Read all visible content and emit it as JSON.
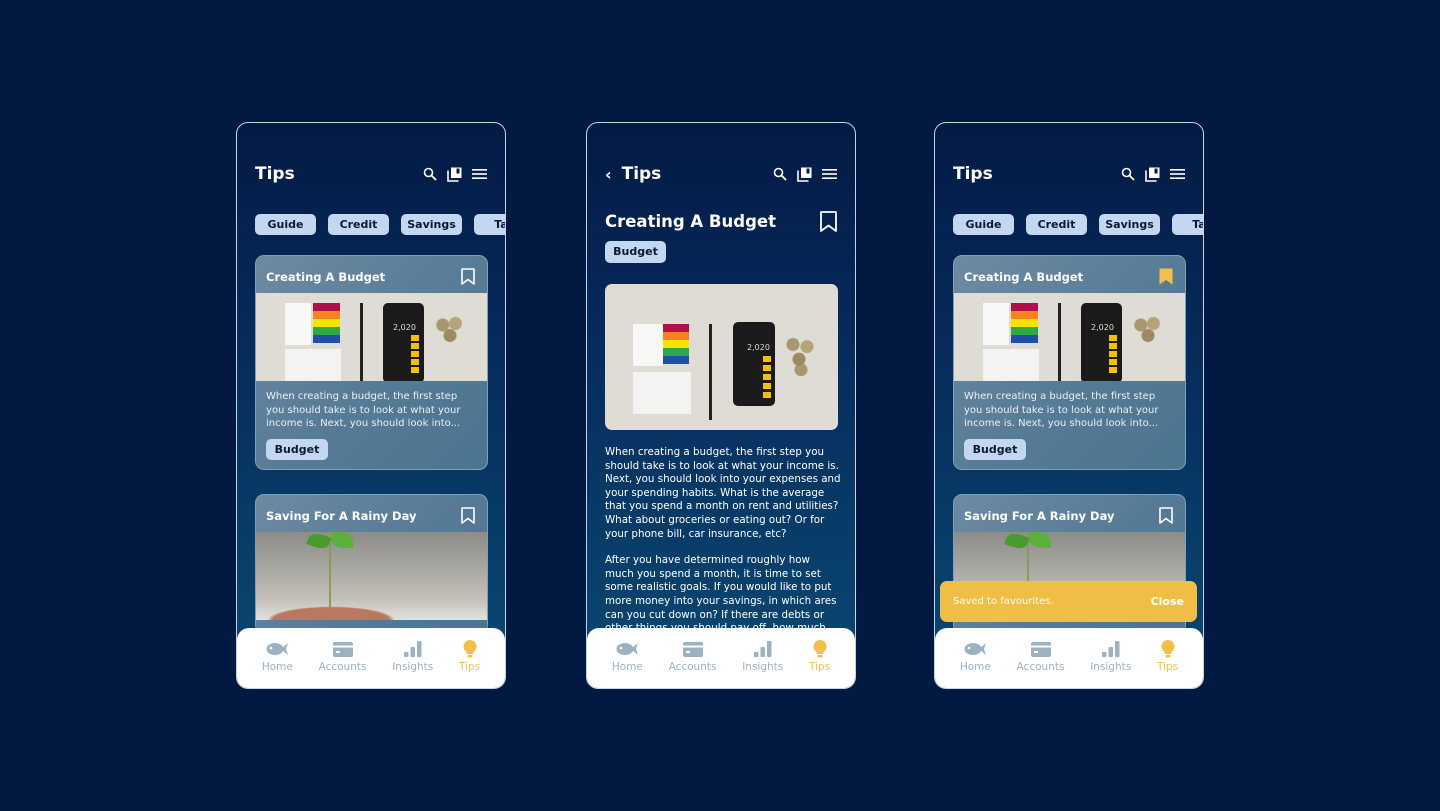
{
  "header": {
    "title": "Tips"
  },
  "categories": [
    "Guide",
    "Credit",
    "Savings",
    "Tax"
  ],
  "cards": [
    {
      "title": "Creating A Budget",
      "excerpt": "When creating a budget, the first step you should take is to look at what your income is. Next, you should look into...",
      "tag": "Budget",
      "image_calc_display": "2,020"
    },
    {
      "title": "Saving For A Rainy Day"
    }
  ],
  "detail": {
    "title": "Creating A Budget",
    "tag": "Budget",
    "paragraphs": [
      "When creating a budget, the first step you should take is to look at what your income is. Next, you should look into your expenses and your spending habits. What is the average that you spend a month on rent and utilities? What about groceries or eating out? Or for your phone bill, car insurance, etc?",
      "After you have determined roughly how much you spend a month, it is time to set some realistic goals. If you would like to put more money into your savings, in which ares can you cut down on? If there are debts or other things you should pay off, how much"
    ]
  },
  "nav": [
    {
      "label": "Home",
      "icon": "fish-icon"
    },
    {
      "label": "Accounts",
      "icon": "card-icon"
    },
    {
      "label": "Insights",
      "icon": "bar-chart-icon"
    },
    {
      "label": "Tips",
      "icon": "lightbulb-icon",
      "active": true
    }
  ],
  "toast": {
    "message": "Saved to favourites.",
    "action": "Close"
  },
  "colors": {
    "background": "#021a42",
    "accent": "#f2c04a",
    "chip": "#c3d7f0",
    "nav_inactive": "#9bb2c3"
  }
}
